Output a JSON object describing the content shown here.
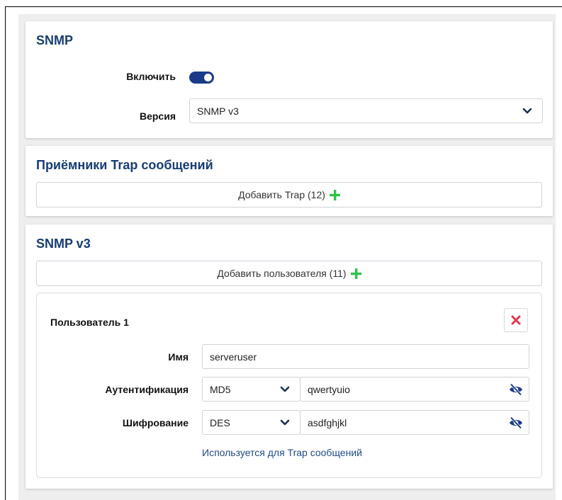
{
  "snmp": {
    "title": "SNMP",
    "enable_label": "Включить",
    "enabled": true,
    "version_label": "Версия",
    "version_value": "SNMP v3"
  },
  "trap": {
    "title": "Приёмники Trap сообщений",
    "add_label": "Добавить Trap (12)"
  },
  "snmpv3": {
    "title": "SNMP v3",
    "add_user_label": "Добавить пользователя (11)",
    "user": {
      "title": "Пользователь 1",
      "name_label": "Имя",
      "name_value": "serveruser",
      "auth_label": "Аутентификация",
      "auth_method": "MD5",
      "auth_password": "qwertyuio",
      "enc_label": "Шифрование",
      "enc_method": "DES",
      "enc_password": "asdfghjkl",
      "trap_link": "Используется для Trap сообщений"
    }
  },
  "icons": {
    "add": "plus-icon",
    "chevron": "chevron-down-icon",
    "delete": "close-icon",
    "password_visibility": "eye-slash-icon"
  },
  "colors": {
    "title": "#173d73",
    "toggle": "#1a3a8a",
    "add_icon": "#2ec24a",
    "delete_icon": "#e0364f",
    "link": "#1f4a8a"
  }
}
